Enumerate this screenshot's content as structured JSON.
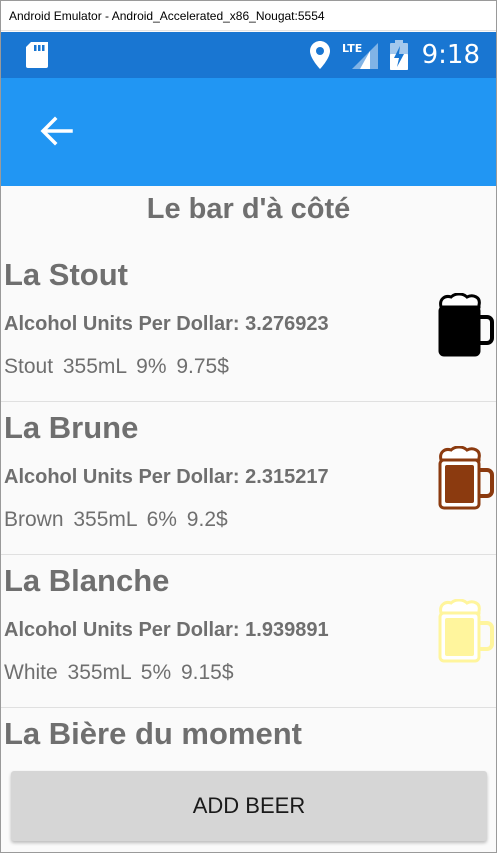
{
  "window": {
    "title": "Android Emulator - Android_Accelerated_x86_Nougat:5554"
  },
  "status_bar": {
    "time": "9:18",
    "network_label": "LTE",
    "icons": [
      "sd-card-icon",
      "location-icon",
      "lte-signal-icon",
      "battery-charging-icon"
    ],
    "color": "#1976d2"
  },
  "app_bar": {
    "color": "#2196f3",
    "back_icon": "back-arrow-icon"
  },
  "page": {
    "title": "Le bar d'à côté"
  },
  "beers": [
    {
      "name": "La Stout",
      "units_text": "Alcohol Units Per Dollar: 3.276923",
      "specs_text": "Stout  355mL  9%  9.75$",
      "icon": "beer-mug-icon",
      "color": "#000000"
    },
    {
      "name": "La Brune",
      "units_text": "Alcohol Units Per Dollar: 2.315217",
      "specs_text": "Brown  355mL  6%  9.2$",
      "icon": "beer-mug-icon",
      "color": "#8b3a0f"
    },
    {
      "name": "La Blanche",
      "units_text": "Alcohol Units Per Dollar: 1.939891",
      "specs_text": "White  355mL  5%  9.15$",
      "icon": "beer-mug-icon",
      "color": "#fff59d"
    },
    {
      "name": "La Bière du moment"
    }
  ],
  "actions": {
    "add_label": "ADD BEER"
  }
}
